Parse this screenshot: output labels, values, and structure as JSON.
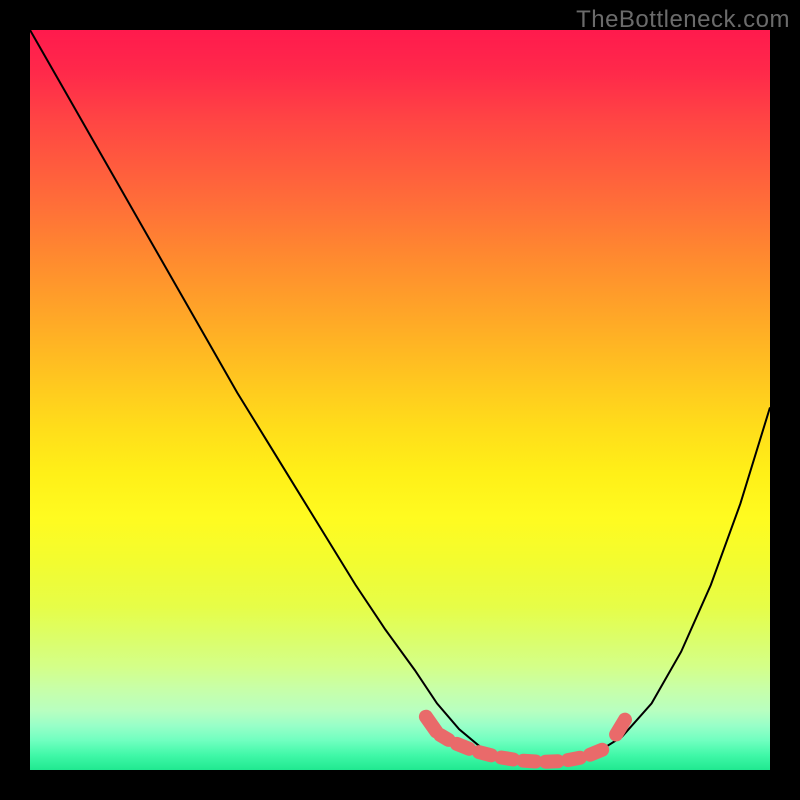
{
  "watermark": "TheBottleneck.com",
  "chart_data": {
    "type": "line",
    "title": "",
    "xlabel": "",
    "ylabel": "",
    "xlim": [
      0,
      100
    ],
    "ylim": [
      0,
      100
    ],
    "grid": false,
    "legend": false,
    "background_gradient": {
      "direction": "vertical",
      "stops": [
        {
          "pos": 0,
          "color": "#ff1a4d"
        },
        {
          "pos": 50,
          "color": "#ffd21f"
        },
        {
          "pos": 85,
          "color": "#d8ff80"
        },
        {
          "pos": 100,
          "color": "#20e890"
        }
      ]
    },
    "description": "Black V-shaped bottleneck curve over a rainbow heat gradient. The curve descends steeply from the top-left, reaches a flat trough near the bottom center-right, then rises toward the right edge. Short thick salmon segments highlight the trough region.",
    "series": [
      {
        "name": "bottleneck-curve",
        "color": "#000000",
        "x": [
          0,
          4,
          8,
          12,
          16,
          20,
          24,
          28,
          32,
          36,
          40,
          44,
          48,
          52,
          55,
          58,
          61,
          64,
          68,
          72,
          76,
          80,
          84,
          88,
          92,
          96,
          100
        ],
        "y": [
          100,
          93,
          86,
          79,
          72,
          65,
          58,
          51,
          44.5,
          38,
          31.5,
          25,
          19,
          13.5,
          9,
          5.5,
          3,
          1.5,
          1,
          1,
          2,
          4.5,
          9,
          16,
          25,
          36,
          49
        ]
      },
      {
        "name": "trough-highlight",
        "color": "#e96a6a",
        "style": "thick-dash",
        "x": [
          55,
          57,
          60,
          63,
          66,
          69,
          72,
          75,
          78
        ],
        "y": [
          5,
          3.8,
          2.6,
          1.8,
          1.3,
          1.1,
          1.2,
          1.8,
          3
        ]
      }
    ]
  }
}
